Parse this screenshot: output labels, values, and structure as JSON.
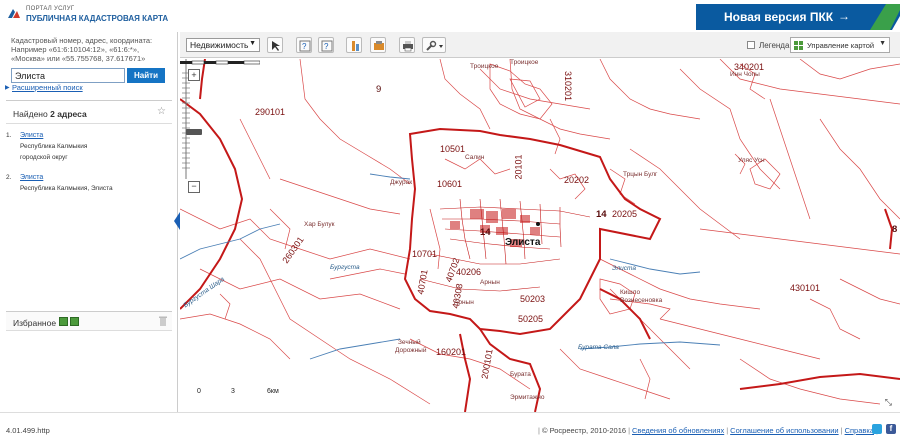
{
  "header": {
    "logo_line1": "ПОРТАЛ УСЛУГ",
    "logo_line2": "ПУБЛИЧНАЯ КАДАСТРОВАЯ КАРТА",
    "new_version_label": "Новая версия ПКК",
    "new_version_arrow": "→"
  },
  "search": {
    "hint": "Кадастровый номер, адрес, координата: Например «61:6:10104:12», «61:6:*», «Москва» или «55.755768, 37.617671»",
    "value": "Элиста",
    "button_label": "Найти",
    "advanced_label": "Расширенный поиск"
  },
  "results": {
    "found_prefix": "Найдено",
    "found_count": "2 адреса",
    "items": [
      {
        "num": "1.",
        "title": "Элиста",
        "line1": "Республика Калмыкия",
        "line2": "городской округ"
      },
      {
        "num": "2.",
        "title": "Элиста",
        "line1": "Республика Калмыкия, Элиста",
        "line2": ""
      }
    ]
  },
  "favorites": {
    "label": "Избранное"
  },
  "toolbar": {
    "layer_select": "Недвижимость",
    "legend_label": "Легенда",
    "map_control_label": "Управление картой"
  },
  "map": {
    "city": "Элиста",
    "quarter_labels": [
      "9",
      "290101",
      "10501",
      "10601",
      "10701",
      "20101",
      "20202",
      "20205",
      "14",
      "40701",
      "40702",
      "40206",
      "40308",
      "50203",
      "50205",
      "160201",
      "200101",
      "260301",
      "310201",
      "340201",
      "430101",
      "8",
      "14"
    ],
    "place_labels": [
      "Троицкое",
      "Троицкое",
      "Инн Чопы",
      "Джурак",
      "Хар Булук",
      "Трцын Булг",
      "Уляс Усн",
      "Арнын",
      "Арнын",
      "Кишло",
      "Вознесеновка",
      "Бурата",
      "Дорожный",
      "Зечный",
      "Эрмитажно",
      "Бургуста",
      "Элиста",
      "Бурата Сала",
      "Бургуста Шара",
      "Салин"
    ],
    "scale": {
      "zero": "0",
      "mid": "3",
      "end": "6км"
    }
  },
  "footer": {
    "version": "4.01.499.http",
    "copyright": "© Росреестр, 2010-2016",
    "link_updates": "Сведения об обновлениях",
    "link_terms": "Соглашение об использовании",
    "link_help": "Справка"
  }
}
